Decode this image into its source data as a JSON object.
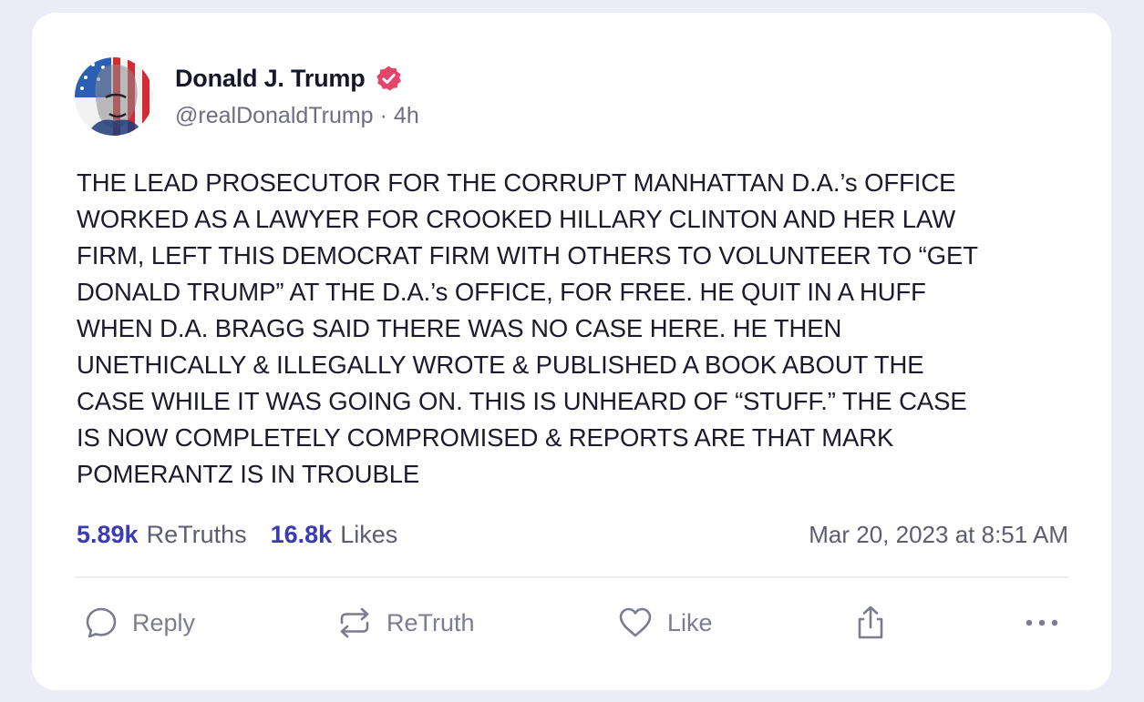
{
  "post": {
    "author": {
      "display_name": "Donald J. Trump",
      "handle": "@realDonaldTrump",
      "separator": "·",
      "time_ago": "4h",
      "verified_icon": "verified-badge-icon"
    },
    "body_lines": [
      "THE LEAD PROSECUTOR FOR THE CORRUPT MANHATTAN D.A.’s OFFICE",
      "WORKED AS A LAWYER FOR CROOKED HILLARY CLINTON AND HER LAW",
      "FIRM, LEFT THIS DEMOCRAT FIRM WITH OTHERS TO VOLUNTEER TO “GET",
      "DONALD TRUMP” AT THE D.A.’s OFFICE, FOR FREE. HE QUIT IN A HUFF",
      "WHEN D.A. BRAGG SAID THERE WAS NO CASE HERE. HE THEN",
      "UNETHICALLY & ILLEGALLY WROTE & PUBLISHED A BOOK ABOUT THE",
      "CASE WHILE IT WAS GOING ON. THIS IS UNHEARD OF “STUFF.” THE CASE",
      "IS NOW COMPLETELY COMPROMISED & REPORTS ARE THAT MARK",
      "POMERANTZ IS IN TROUBLE"
    ],
    "stats": {
      "retruths_value": "5.89k",
      "retruths_label": "ReTruths",
      "likes_value": "16.8k",
      "likes_label": "Likes"
    },
    "timestamp": "Mar 20, 2023 at 8:51 AM"
  },
  "actions": {
    "reply_label": "Reply",
    "retruth_label": "ReTruth",
    "like_label": "Like",
    "icons": [
      "reply-icon",
      "retruth-icon",
      "heart-icon",
      "share-icon",
      "more-icon"
    ]
  },
  "colors": {
    "accent": "#3a3bb5",
    "verified": "#e6456a",
    "background": "#ececf8",
    "card": "#ffffff"
  }
}
